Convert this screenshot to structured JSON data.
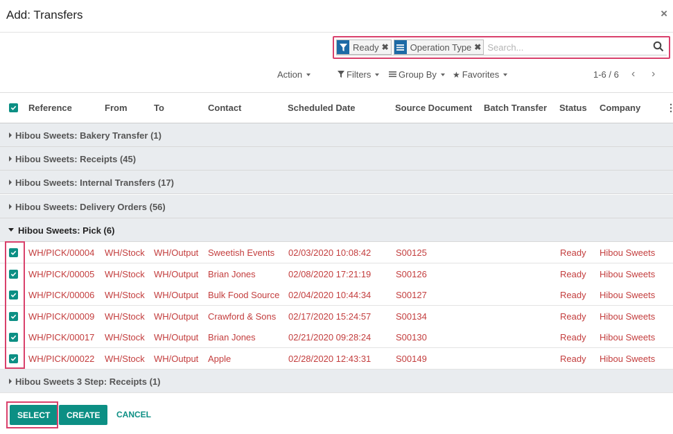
{
  "dialog": {
    "title": "Add: Transfers",
    "close_glyph": "×"
  },
  "search": {
    "facets": [
      {
        "label": "Ready",
        "icon": "filter-icon"
      },
      {
        "label": "Operation Type",
        "icon": "group-by-icon"
      }
    ],
    "placeholder": "Search..."
  },
  "controls": {
    "action": "Action",
    "filters": "Filters",
    "group_by": "Group By",
    "favorites": "Favorites",
    "pager": "1-6 / 6"
  },
  "table": {
    "headers": [
      "Reference",
      "From",
      "To",
      "Contact",
      "Scheduled Date",
      "Source Document",
      "Batch Transfer",
      "Status",
      "Company"
    ],
    "groups_before": [
      {
        "label": "Hibou Sweets: Bakery Transfer (1)"
      },
      {
        "label": "Hibou Sweets: Receipts (45)"
      },
      {
        "label": "Hibou Sweets: Internal Transfers (17)"
      },
      {
        "label": "Hibou Sweets: Delivery Orders (56)"
      }
    ],
    "open_group": {
      "label": "Hibou Sweets: Pick (6)"
    },
    "rows": [
      {
        "reference": "WH/PICK/00004",
        "from": "WH/Stock",
        "to": "WH/Output",
        "contact": "Sweetish Events",
        "scheduled": "02/03/2020 10:08:42",
        "source": "S00125",
        "batch": "",
        "status": "Ready",
        "company": "Hibou Sweets",
        "checked": true
      },
      {
        "reference": "WH/PICK/00005",
        "from": "WH/Stock",
        "to": "WH/Output",
        "contact": "Brian Jones",
        "scheduled": "02/08/2020 17:21:19",
        "source": "S00126",
        "batch": "",
        "status": "Ready",
        "company": "Hibou Sweets",
        "checked": true
      },
      {
        "reference": "WH/PICK/00006",
        "from": "WH/Stock",
        "to": "WH/Output",
        "contact": "Bulk Food Source",
        "scheduled": "02/04/2020 10:44:34",
        "source": "S00127",
        "batch": "",
        "status": "Ready",
        "company": "Hibou Sweets",
        "checked": true
      },
      {
        "reference": "WH/PICK/00009",
        "from": "WH/Stock",
        "to": "WH/Output",
        "contact": "Crawford & Sons",
        "scheduled": "02/17/2020 15:24:57",
        "source": "S00134",
        "batch": "",
        "status": "Ready",
        "company": "Hibou Sweets",
        "checked": true
      },
      {
        "reference": "WH/PICK/00017",
        "from": "WH/Stock",
        "to": "WH/Output",
        "contact": "Brian Jones",
        "scheduled": "02/21/2020 09:28:24",
        "source": "S00130",
        "batch": "",
        "status": "Ready",
        "company": "Hibou Sweets",
        "checked": true
      },
      {
        "reference": "WH/PICK/00022",
        "from": "WH/Stock",
        "to": "WH/Output",
        "contact": "Apple",
        "scheduled": "02/28/2020 12:43:31",
        "source": "S00149",
        "batch": "",
        "status": "Ready",
        "company": "Hibou Sweets",
        "checked": true
      }
    ],
    "group_after": {
      "label": "Hibou Sweets 3 Step: Receipts (1)"
    }
  },
  "footer": {
    "select": "SELECT",
    "create": "CREATE",
    "cancel": "CANCEL"
  },
  "colors": {
    "accent": "#0c8f84",
    "highlight": "#d9406b",
    "row_text": "#c33d3d",
    "facet_icon": "#1d6aa6"
  }
}
